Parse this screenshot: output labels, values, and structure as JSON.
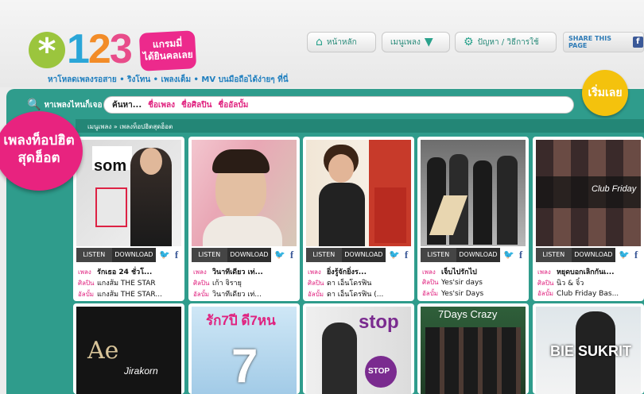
{
  "logo": {
    "symbol": "*",
    "digits": [
      "1",
      "2",
      "3"
    ],
    "badge_line1": "แกรมมี่",
    "badge_line2": "ได้ยินคลเลย"
  },
  "tagline": "หาโหลดเพลงรอสาย • ริงโทน • เพลงเต็ม • MV  บนมือถือได้ง่ายๆ ที่นี่",
  "nav": {
    "home": "หน้าหลัก",
    "menu": "เมนูเพลง",
    "help": "ปัญหา / วิธีการใช้",
    "share": "SHARE THIS PAGE",
    "share_fb": "f"
  },
  "search": {
    "label": "หาเพลงไหนก็เจอ",
    "placeholder": "ค้นหา...",
    "hint_song": "ชื่อเพลง",
    "hint_artist": "ชื่อศิลปิน",
    "hint_album": "ชื่ออัลบั้ม"
  },
  "start_button": "เริ่มเลย",
  "breadcrumb": "เมนูเพลง » เพลงท็อปฮิตสุดฮ็อต",
  "hot_bubble": {
    "line1": "เพลงท็อปฮิต",
    "line2": "สุดฮ็อต"
  },
  "buttons": {
    "listen": "LISTEN",
    "download": "DOWNLOAD",
    "twitter": "🐦",
    "facebook": "f"
  },
  "labels": {
    "song": "เพลง",
    "artist": "ศิลปิน",
    "album": "อัลบั้ม"
  },
  "songs": [
    {
      "title": "รักเธอ 24 ชั่วโ...",
      "artist": "แกงส้ม THE STAR",
      "album": "แกงส้ม THE STAR...",
      "cover_text": "som"
    },
    {
      "title": "วินาทีเดียว เท่...",
      "artist": "เก้า จิรายุ",
      "album": "วินาทีเดียว เท่...",
      "cover_text": ""
    },
    {
      "title": "ยิ่งรู้จักยิ่งร...",
      "artist": "ดา เอ็นโดรฟิน",
      "album": "ดา เอ็นโดรฟิน (...",
      "cover_text": ""
    },
    {
      "title": "เจ็บไปรักไป",
      "artist": "Yes'sir days",
      "album": "Yes'sir Days",
      "cover_text": ""
    },
    {
      "title": "หยุดบอกเลิกกันเ...",
      "artist": "นิว & จิ๋ว",
      "album": "Club Friday Bas...",
      "cover_text": "Club Friday"
    }
  ],
  "bottom_covers": [
    {
      "text": "Ae",
      "sub": "Jirakorn"
    },
    {
      "text": "รัก7ปี ดี7หน",
      "sub": "7"
    },
    {
      "text": "stop",
      "sub": "STOP"
    },
    {
      "text": "7Days Crazy",
      "sub": ""
    },
    {
      "text": "BIE SUKRIT",
      "sub": ""
    }
  ]
}
